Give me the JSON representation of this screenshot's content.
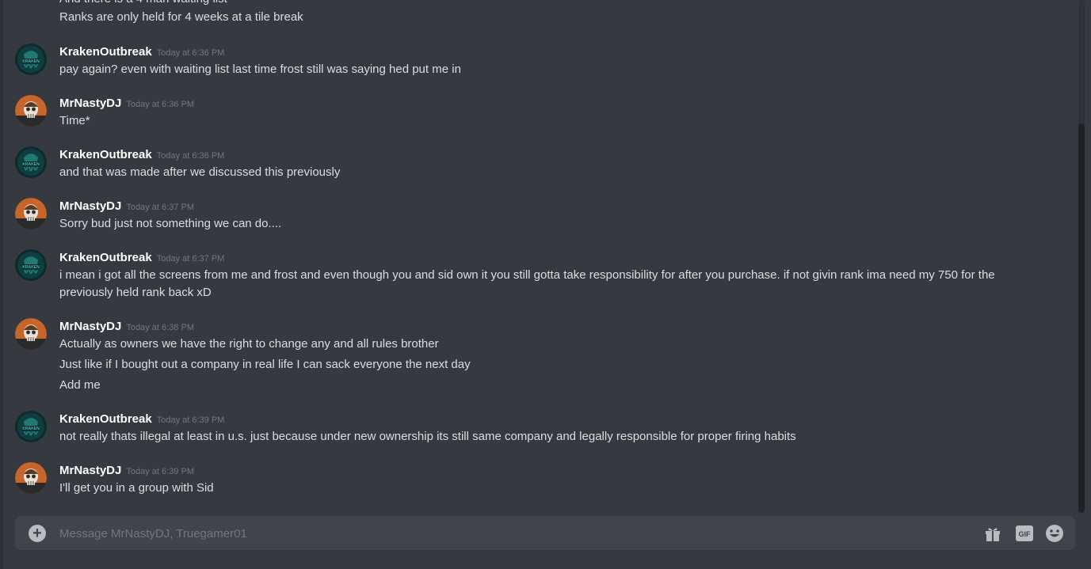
{
  "continuation": {
    "partial_line": "And there is a 4 man waiting list",
    "line": "Ranks are only held for 4 weeks at a tile break"
  },
  "groups": [
    {
      "user": "KrakenOutbreak",
      "avatar": "kraken-avatar",
      "time": "Today at 6:36 PM",
      "lines": [
        "pay again? even with waiting list last time frost still was saying hed put me in"
      ]
    },
    {
      "user": "MrNastyDJ",
      "avatar": "skull-avatar",
      "time": "Today at 6:36 PM",
      "lines": [
        "Time*"
      ]
    },
    {
      "user": "KrakenOutbreak",
      "avatar": "kraken-avatar",
      "time": "Today at 6:36 PM",
      "lines": [
        "and that was made after we discussed this previously"
      ]
    },
    {
      "user": "MrNastyDJ",
      "avatar": "skull-avatar",
      "time": "Today at 6:37 PM",
      "lines": [
        "Sorry bud just not something we can do...."
      ]
    },
    {
      "user": "KrakenOutbreak",
      "avatar": "kraken-avatar",
      "time": "Today at 6:37 PM",
      "lines": [
        "i mean i got all the screens from me and frost and even though you and sid own it you still gotta take responsibility for after you purchase. if not givin rank ima need my 750 for the previously held rank back xD"
      ]
    },
    {
      "user": "MrNastyDJ",
      "avatar": "skull-avatar",
      "time": "Today at 6:38 PM",
      "lines": [
        "Actually as owners we have the right to change any and all rules brother",
        "Just like if I bought out a company in real life I can sack everyone the next day",
        "Add me"
      ]
    },
    {
      "user": "KrakenOutbreak",
      "avatar": "kraken-avatar",
      "time": "Today at 6:39 PM",
      "lines": [
        "not really thats illegal at least in u.s. just because under new ownership its still same company and legally responsible for proper firing habits"
      ]
    },
    {
      "user": "MrNastyDJ",
      "avatar": "skull-avatar",
      "time": "Today at 6:39 PM",
      "lines": [
        "I'll get you in a group with Sid"
      ]
    }
  ],
  "composer": {
    "placeholder": "Message MrNastyDJ, Truegamer01",
    "add_icon": "plus-circle-icon",
    "gift_icon": "gift-icon",
    "gif_label": "GIF",
    "emoji_icon": "emoji-icon"
  },
  "colors": {
    "background": "#36393f",
    "composer": "#40444b",
    "text": "#dcddde",
    "username": "#ffffff",
    "timestamp": "#72767d"
  }
}
